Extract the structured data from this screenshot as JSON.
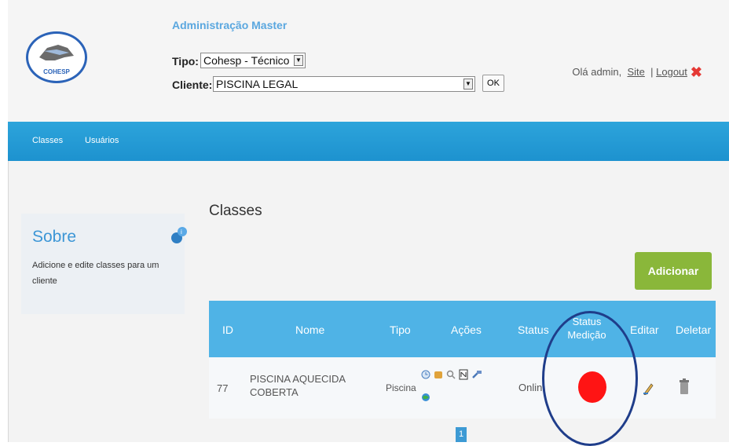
{
  "header": {
    "logo_text": "COHESP",
    "admin_title": "Administração Master",
    "tipo_label": "Tipo:",
    "tipo_value": "Cohesp - Técnico",
    "cliente_label": "Cliente:",
    "cliente_value": "PISCINA LEGAL",
    "ok_label": "OK",
    "greeting": "Olá admin,",
    "site_link": "Site",
    "separator": "|",
    "logout_link": "Logout"
  },
  "nav": {
    "items": [
      {
        "label": "Classes"
      },
      {
        "label": "Usuários"
      }
    ]
  },
  "sidebar": {
    "title": "Sobre",
    "description": "Adicione e edite classes para um cliente"
  },
  "main": {
    "title": "Classes",
    "add_button": "Adicionar",
    "table": {
      "columns": [
        "ID",
        "Nome",
        "Tipo",
        "Ações",
        "Status",
        "Status Medição",
        "Editar",
        "Deletar"
      ],
      "rows": [
        {
          "id": "77",
          "nome": "PISCINA AQUECIDA COBERTA",
          "tipo": "Piscina",
          "status": "Online",
          "status_medicao_color": "#ff1414"
        }
      ]
    },
    "pagination": {
      "current": "1"
    }
  },
  "colors": {
    "nav_blue": "#1d92cf",
    "table_header": "#4fb3e6",
    "add_green": "#8ab73a",
    "status_red": "#ff1414",
    "highlight_ring": "#1f3d8a"
  }
}
